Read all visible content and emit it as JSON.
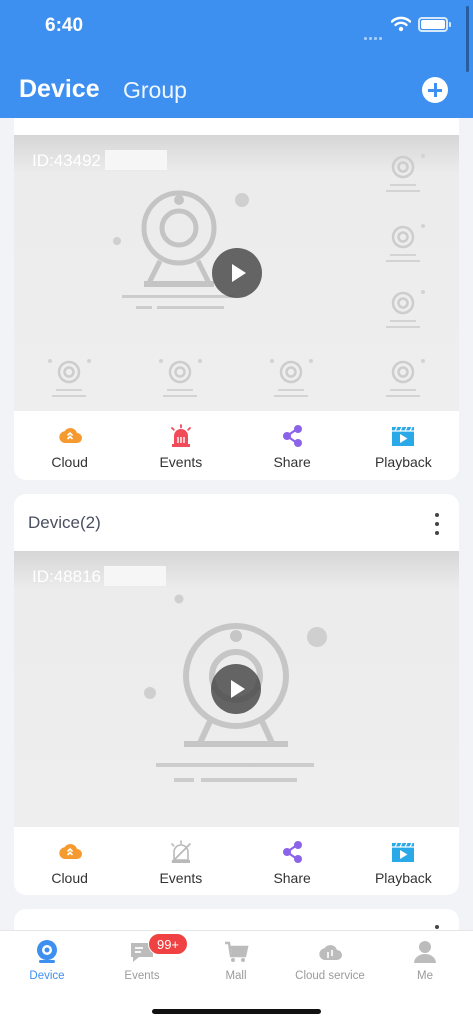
{
  "status_bar": {
    "time": "6:40"
  },
  "header": {
    "tabs": [
      "Device",
      "Group"
    ]
  },
  "devices": [
    {
      "title": "",
      "id_prefix": "ID:43492",
      "actions": [
        {
          "label": "Cloud",
          "icon": "cloud-icon",
          "color": "#f59a2f"
        },
        {
          "label": "Events",
          "icon": "alarm-siren-icon",
          "color": "#f14b5a"
        },
        {
          "label": "Share",
          "icon": "share-icon",
          "color": "#8a63e8"
        },
        {
          "label": "Playback",
          "icon": "playback-icon",
          "color": "#29a9e8"
        }
      ]
    },
    {
      "title": "Device(2)",
      "id_prefix": "ID:48816",
      "actions": [
        {
          "label": "Cloud",
          "icon": "cloud-icon",
          "color": "#f59a2f"
        },
        {
          "label": "Events",
          "icon": "alarm-off-icon",
          "color": "#b9b9b9"
        },
        {
          "label": "Share",
          "icon": "share-icon",
          "color": "#8a63e8"
        },
        {
          "label": "Playback",
          "icon": "playback-icon",
          "color": "#29a9e8"
        }
      ]
    }
  ],
  "bottom_nav": {
    "items": [
      {
        "label": "Device",
        "icon": "camera-icon",
        "active": true
      },
      {
        "label": "Events",
        "icon": "message-icon",
        "badge": "99+"
      },
      {
        "label": "Mall",
        "icon": "cart-icon"
      },
      {
        "label": "Cloud service",
        "icon": "cloud-service-icon"
      },
      {
        "label": "Me",
        "icon": "person-icon"
      }
    ]
  },
  "colors": {
    "accent": "#3d8ff0",
    "badge": "#f04242",
    "background": "#f1f3f7"
  }
}
